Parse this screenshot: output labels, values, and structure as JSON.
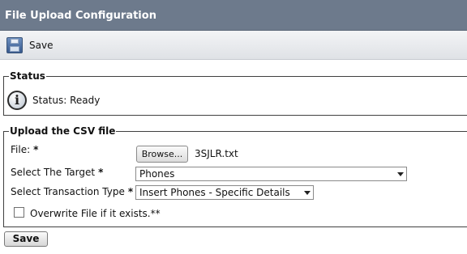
{
  "header": {
    "title": "File Upload Configuration"
  },
  "toolbar": {
    "save_label": "Save",
    "save_icon": "floppy-disk-icon"
  },
  "status_section": {
    "legend": "Status",
    "icon": "info-icon",
    "text": "Status: Ready"
  },
  "csv_section": {
    "legend": "Upload the CSV file",
    "file": {
      "label": "File:",
      "required_mark": "*",
      "browse_label": "Browse...",
      "filename": "3SJLR.txt"
    },
    "target": {
      "label": "Select The Target",
      "required_mark": "*",
      "selected": "Phones"
    },
    "transaction": {
      "label": "Select Transaction Type",
      "required_mark": "*",
      "selected": "Insert Phones - Specific Details"
    },
    "overwrite": {
      "label": "Overwrite File if it exists.**",
      "checked": false
    }
  },
  "footer": {
    "save_label": "Save"
  },
  "colors": {
    "title_bar": "#6d7a8c",
    "toolbar": "#e6e8eb"
  }
}
